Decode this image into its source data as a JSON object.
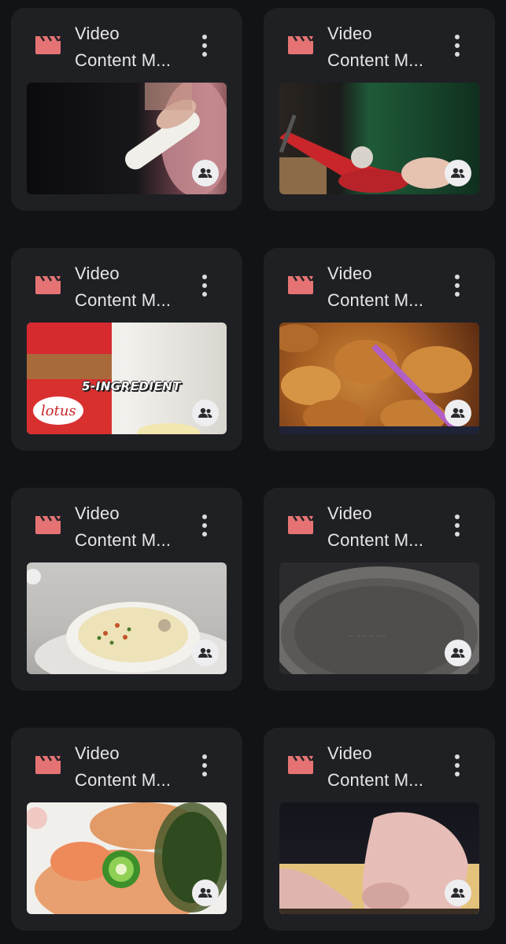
{
  "colors": {
    "background": "#121316",
    "card": "#1f2024",
    "accent_icon": "#e57373",
    "text": "#e6e6e9"
  },
  "icons": {
    "type": "video-clapperboard-icon",
    "menu": "more-vertical-icon",
    "shared": "people-icon"
  },
  "cards": [
    {
      "title_line1": "Video",
      "title_line2": "Content M...",
      "thumbnail": "hand-holding-roller"
    },
    {
      "title_line1": "Video",
      "title_line2": "Content M...",
      "thumbnail": "red-pot-stirring"
    },
    {
      "title_line1": "Video",
      "title_line2": "Content M...",
      "thumbnail": "lotus-spread-jar",
      "overlay_text": "5-INGREDIENT"
    },
    {
      "title_line1": "Video",
      "title_line2": "Content M...",
      "thumbnail": "glazed-chicken-chopsticks"
    },
    {
      "title_line1": "Video",
      "title_line2": "Content M...",
      "thumbnail": "soup-bowl"
    },
    {
      "title_line1": "Video",
      "title_line2": "Content M...",
      "thumbnail": "empty-pan"
    },
    {
      "title_line1": "Video",
      "title_line2": "Content M...",
      "thumbnail": "salmon-tostada-jalapeno"
    },
    {
      "title_line1": "Video",
      "title_line2": "Content M...",
      "thumbnail": "hands-folding-dough"
    }
  ]
}
